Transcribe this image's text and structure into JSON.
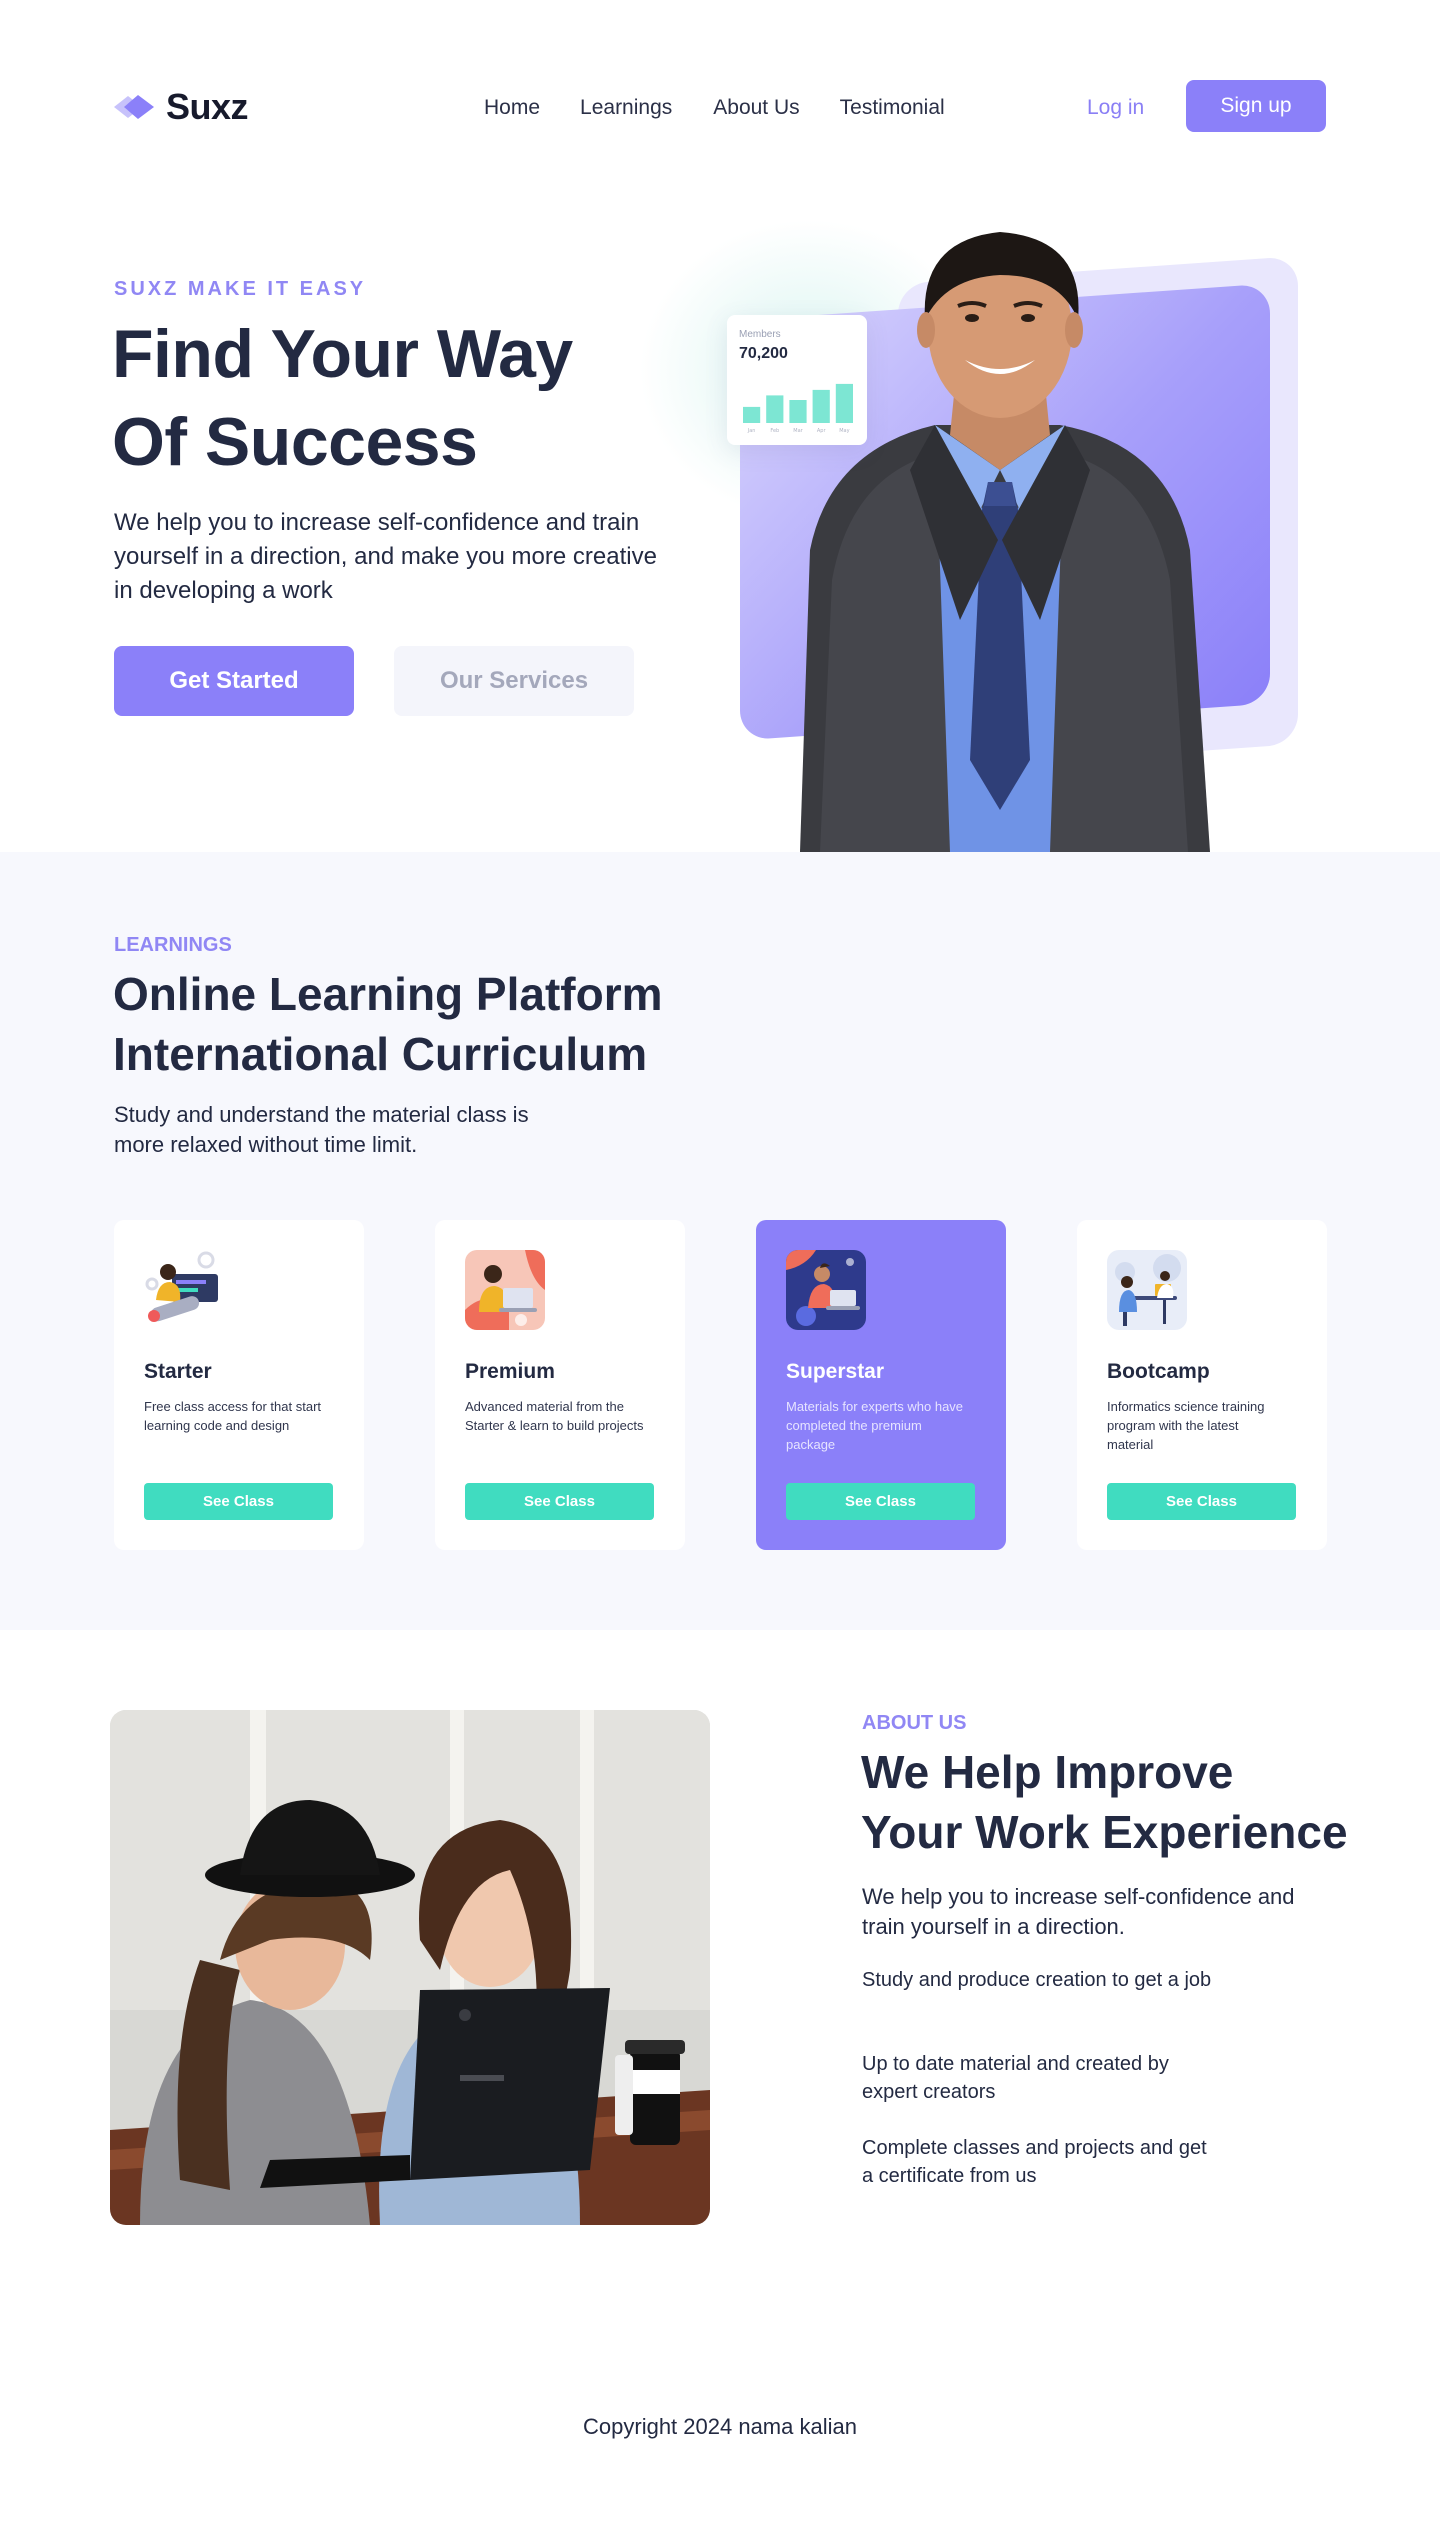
{
  "brand": {
    "name": "Suxz",
    "accent": "#8b80f9",
    "teal": "#40dcc0",
    "dark": "#232a42"
  },
  "nav": {
    "links": [
      "Home",
      "Learnings",
      "About Us",
      "Testimonial"
    ],
    "login": "Log in",
    "signup": "Sign up"
  },
  "hero": {
    "eyebrow": "SUXZ MAKE IT EASY",
    "title_line1": "Find Your Way",
    "title_line2": "Of Success",
    "description": "We help you to increase self-confidence and train yourself in a direction, and make you more creative in developing a work",
    "primary_button": "Get Started",
    "secondary_button": "Our Services",
    "members_widget": {
      "label": "Members",
      "value": "70,200",
      "bar_levels": [
        0.35,
        0.6,
        0.5,
        0.72,
        0.85
      ],
      "bar_labels": [
        "Jan",
        "Feb",
        "Mar",
        "Apr",
        "May"
      ]
    }
  },
  "learnings": {
    "eyebrow": "LEARNINGS",
    "title_line1": "Online Learning Platform",
    "title_line2": "International Curriculum",
    "description": "Study and understand the material class is more relaxed without time limit.",
    "plans": [
      {
        "name": "Starter",
        "description": "Free class access for that start learning code and design",
        "button": "See Class",
        "icon": "developer-illustration-icon"
      },
      {
        "name": "Premium",
        "description": "Advanced material from the Starter & learn to build projects",
        "button": "See Class",
        "icon": "laptop-learner-illustration-icon"
      },
      {
        "name": "Superstar",
        "description": "Materials for experts who have completed the premium package",
        "button": "See Class",
        "icon": "expert-illustration-icon"
      },
      {
        "name": "Bootcamp",
        "description": "Informatics science training program with the latest material",
        "button": "See Class",
        "icon": "team-desk-illustration-icon"
      }
    ]
  },
  "about": {
    "eyebrow": "ABOUT US",
    "title_line1": "We Help Improve",
    "title_line2": "Your Work Experience",
    "description": "We help you to increase self-confidence and train yourself in a direction.",
    "points": [
      "Study and produce creation to get a job",
      "Up to date material and created by expert creators",
      "Complete classes and projects and get a certificate from us"
    ]
  },
  "footer": {
    "copyright": "Copyright 2024 nama kalian"
  }
}
